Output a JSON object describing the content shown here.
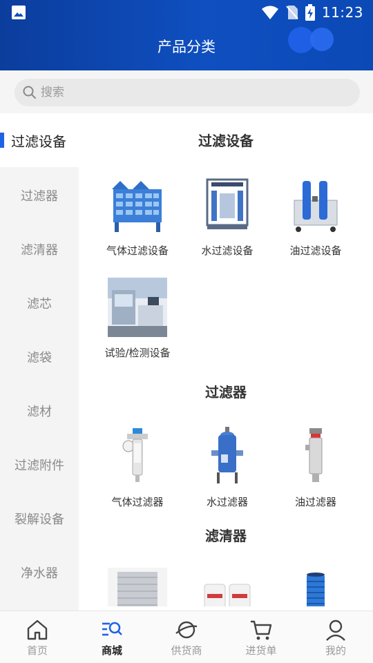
{
  "status_bar": {
    "time": "11:23"
  },
  "header": {
    "title": "产品分类"
  },
  "search": {
    "placeholder": "搜索"
  },
  "sidebar": {
    "items": [
      {
        "label": "过滤设备",
        "active": true
      },
      {
        "label": "过滤器"
      },
      {
        "label": "滤清器"
      },
      {
        "label": "滤芯"
      },
      {
        "label": "滤袋"
      },
      {
        "label": "滤材"
      },
      {
        "label": "过滤附件"
      },
      {
        "label": "裂解设备"
      },
      {
        "label": "净水器"
      }
    ]
  },
  "content": {
    "sections": [
      {
        "title": "过滤设备",
        "products": [
          "气体过滤设备",
          "水过滤设备",
          "油过滤设备",
          "试验/检测设备"
        ]
      },
      {
        "title": "过滤器",
        "products": [
          "气体过滤器",
          "水过滤器",
          "油过滤器"
        ]
      },
      {
        "title": "滤清器",
        "products": [
          "",
          "",
          ""
        ]
      }
    ]
  },
  "bottom_nav": {
    "items": [
      {
        "label": "首页",
        "icon": "home-icon"
      },
      {
        "label": "商城",
        "icon": "mall-icon",
        "active": true
      },
      {
        "label": "供货商",
        "icon": "planet-icon"
      },
      {
        "label": "进货单",
        "icon": "cart-icon"
      },
      {
        "label": "我的",
        "icon": "user-icon"
      }
    ]
  },
  "colors": {
    "header": "#0f4fc0",
    "accent": "#1e62e8"
  }
}
